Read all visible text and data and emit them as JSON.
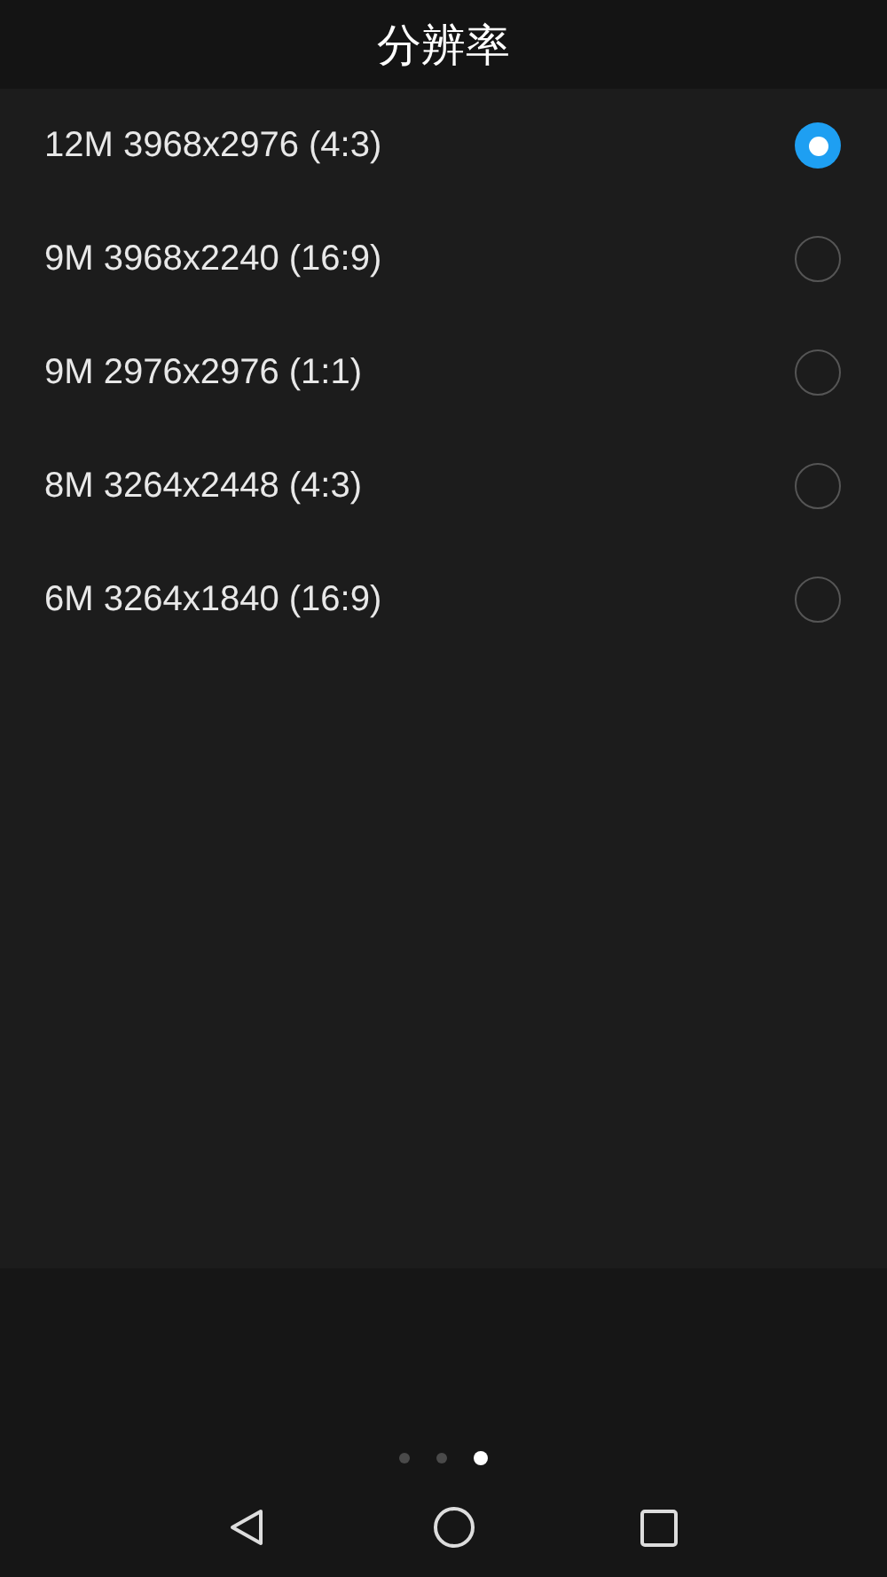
{
  "title": "分辨率",
  "options": [
    {
      "label": "12M 3968x2976 (4:3)",
      "selected": true
    },
    {
      "label": "9M 3968x2240 (16:9)",
      "selected": false
    },
    {
      "label": "9M 2976x2976 (1:1)",
      "selected": false
    },
    {
      "label": "8M 3264x2448 (4:3)",
      "selected": false
    },
    {
      "label": "6M 3264x1840 (16:9)",
      "selected": false
    }
  ],
  "pages": [
    {
      "selected": false
    },
    {
      "selected": false
    },
    {
      "selected": true
    }
  ]
}
